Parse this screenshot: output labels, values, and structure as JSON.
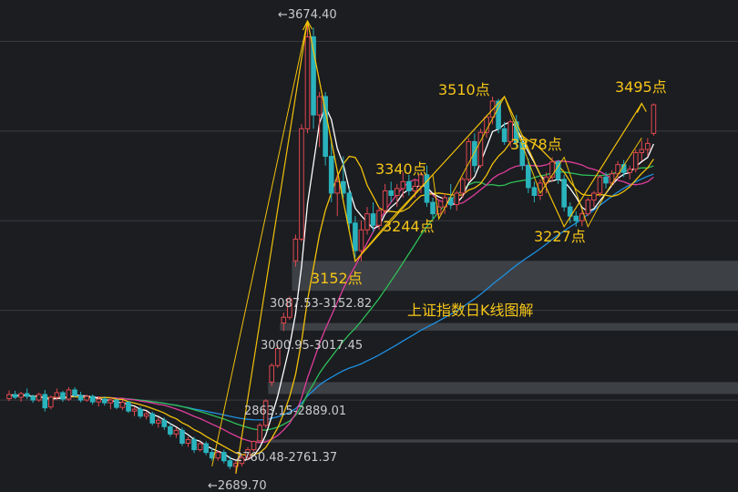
{
  "chart_data": {
    "type": "candlestick",
    "title": "上证指数日K线图解",
    "ylim": [
      2650,
      3720
    ],
    "gridlines": [
      3630,
      3435,
      3240,
      3045,
      2850
    ],
    "gap_zones": [
      {
        "low": 3087.53,
        "high": 3152.82,
        "label": "3087.53-3152.82"
      },
      {
        "low": 3000.95,
        "high": 3017.45,
        "label": "3000.95-3017.45"
      },
      {
        "low": 2863.15,
        "high": 2889.01,
        "label": "2863.15-2889.01"
      },
      {
        "low": 2760.48,
        "high": 2761.37,
        "label": "2760.48-2761.37"
      }
    ],
    "extremes": [
      {
        "label": "←3674.40",
        "value": 3674.4
      },
      {
        "label": "←2689.70",
        "value": 2689.7
      }
    ],
    "pivot_labels": [
      {
        "label": "3152点",
        "value": 3152
      },
      {
        "label": "3244点",
        "value": 3244
      },
      {
        "label": "3340点",
        "value": 3340
      },
      {
        "label": "3510点",
        "value": 3510
      },
      {
        "label": "3378点",
        "value": 3378
      },
      {
        "label": "3227点",
        "value": 3227
      },
      {
        "label": "3495点",
        "value": 3495
      }
    ],
    "candles": [
      [
        2853,
        2871,
        2848,
        2862
      ],
      [
        2862,
        2870,
        2852,
        2856
      ],
      [
        2856,
        2868,
        2846,
        2864
      ],
      [
        2864,
        2875,
        2852,
        2858
      ],
      [
        2858,
        2862,
        2844,
        2850
      ],
      [
        2850,
        2866,
        2846,
        2862
      ],
      [
        2862,
        2872,
        2825,
        2833
      ],
      [
        2835,
        2860,
        2830,
        2856
      ],
      [
        2856,
        2875,
        2850,
        2866
      ],
      [
        2866,
        2870,
        2846,
        2852
      ],
      [
        2852,
        2878,
        2848,
        2872
      ],
      [
        2872,
        2878,
        2855,
        2860
      ],
      [
        2860,
        2868,
        2845,
        2850
      ],
      [
        2850,
        2862,
        2846,
        2858
      ],
      [
        2858,
        2862,
        2840,
        2846
      ],
      [
        2846,
        2858,
        2836,
        2852
      ],
      [
        2852,
        2858,
        2838,
        2844
      ],
      [
        2844,
        2856,
        2830,
        2850
      ],
      [
        2850,
        2852,
        2830,
        2834
      ],
      [
        2834,
        2850,
        2828,
        2845
      ],
      [
        2845,
        2848,
        2822,
        2826
      ],
      [
        2826,
        2836,
        2815,
        2830
      ],
      [
        2830,
        2836,
        2810,
        2815
      ],
      [
        2815,
        2826,
        2808,
        2820
      ],
      [
        2820,
        2825,
        2795,
        2800
      ],
      [
        2800,
        2812,
        2790,
        2806
      ],
      [
        2806,
        2812,
        2785,
        2792
      ],
      [
        2792,
        2800,
        2770,
        2776
      ],
      [
        2776,
        2790,
        2768,
        2784
      ],
      [
        2784,
        2790,
        2750,
        2756
      ],
      [
        2756,
        2770,
        2748,
        2764
      ],
      [
        2764,
        2770,
        2735,
        2742
      ],
      [
        2742,
        2760,
        2738,
        2755
      ],
      [
        2755,
        2760,
        2730,
        2736
      ],
      [
        2736,
        2745,
        2718,
        2724
      ],
      [
        2724,
        2740,
        2718,
        2736
      ],
      [
        2736,
        2742,
        2712,
        2718
      ],
      [
        2718,
        2728,
        2700,
        2706
      ],
      [
        2706,
        2718,
        2689.7,
        2712
      ],
      [
        2712,
        2730,
        2706,
        2725
      ],
      [
        2725,
        2748,
        2720,
        2742
      ],
      [
        2742,
        2762,
        2738,
        2760
      ],
      [
        2761.37,
        2800,
        2760,
        2795
      ],
      [
        2795,
        2852,
        2790,
        2848
      ],
      [
        2889.01,
        2930,
        2880,
        2925
      ],
      [
        2925,
        2970,
        2920,
        2962
      ],
      [
        3017.45,
        3040,
        3000,
        3030
      ],
      [
        3030,
        3075,
        3025,
        3070
      ],
      [
        3152.82,
        3210,
        3140,
        3200
      ],
      [
        3200,
        3450,
        3195,
        3440
      ],
      [
        3440,
        3674.4,
        3430,
        3640
      ],
      [
        3640,
        3660,
        3440,
        3470
      ],
      [
        3470,
        3520,
        3400,
        3510
      ],
      [
        3510,
        3520,
        3360,
        3380
      ],
      [
        3380,
        3420,
        3280,
        3300
      ],
      [
        3300,
        3340,
        3250,
        3325
      ],
      [
        3325,
        3380,
        3290,
        3300
      ],
      [
        3300,
        3310,
        3220,
        3235
      ],
      [
        3235,
        3250,
        3160,
        3175
      ],
      [
        3175,
        3240,
        3152,
        3220
      ],
      [
        3220,
        3270,
        3210,
        3255
      ],
      [
        3255,
        3280,
        3215,
        3230
      ],
      [
        3230,
        3270,
        3220,
        3262
      ],
      [
        3262,
        3320,
        3255,
        3305
      ],
      [
        3305,
        3325,
        3280,
        3295
      ],
      [
        3295,
        3320,
        3270,
        3310
      ],
      [
        3310,
        3345,
        3290,
        3325
      ],
      [
        3325,
        3340,
        3295,
        3305
      ],
      [
        3305,
        3330,
        3290,
        3315
      ],
      [
        3315,
        3345,
        3300,
        3340
      ],
      [
        3340,
        3360,
        3270,
        3280
      ],
      [
        3280,
        3290,
        3244,
        3255
      ],
      [
        3255,
        3285,
        3244,
        3270
      ],
      [
        3270,
        3300,
        3255,
        3290
      ],
      [
        3290,
        3320,
        3265,
        3275
      ],
      [
        3275,
        3305,
        3262,
        3300
      ],
      [
        3300,
        3335,
        3290,
        3330
      ],
      [
        3330,
        3420,
        3325,
        3412
      ],
      [
        3412,
        3430,
        3345,
        3360
      ],
      [
        3360,
        3440,
        3355,
        3432
      ],
      [
        3432,
        3470,
        3420,
        3465
      ],
      [
        3465,
        3510,
        3450,
        3500
      ],
      [
        3500,
        3505,
        3430,
        3440
      ],
      [
        3440,
        3455,
        3405,
        3412
      ],
      [
        3412,
        3460,
        3400,
        3455
      ],
      [
        3455,
        3470,
        3400,
        3410
      ],
      [
        3410,
        3420,
        3350,
        3360
      ],
      [
        3360,
        3375,
        3300,
        3312
      ],
      [
        3312,
        3325,
        3280,
        3295
      ],
      [
        3295,
        3330,
        3285,
        3322
      ],
      [
        3322,
        3345,
        3300,
        3335
      ],
      [
        3335,
        3378,
        3325,
        3368
      ],
      [
        3368,
        3372,
        3320,
        3330
      ],
      [
        3330,
        3340,
        3260,
        3270
      ],
      [
        3270,
        3280,
        3235,
        3250
      ],
      [
        3250,
        3260,
        3227,
        3240
      ],
      [
        3240,
        3262,
        3228,
        3255
      ],
      [
        3255,
        3290,
        3250,
        3285
      ],
      [
        3285,
        3305,
        3270,
        3300
      ],
      [
        3300,
        3340,
        3292,
        3335
      ],
      [
        3335,
        3345,
        3310,
        3322
      ],
      [
        3322,
        3350,
        3315,
        3342
      ],
      [
        3342,
        3370,
        3330,
        3362
      ],
      [
        3362,
        3372,
        3335,
        3345
      ],
      [
        3345,
        3360,
        3330,
        3352
      ],
      [
        3352,
        3395,
        3345,
        3388
      ],
      [
        3388,
        3415,
        3370,
        3395
      ],
      [
        3395,
        3420,
        3380,
        3408
      ],
      [
        3430,
        3495,
        3425,
        3492
      ]
    ]
  }
}
